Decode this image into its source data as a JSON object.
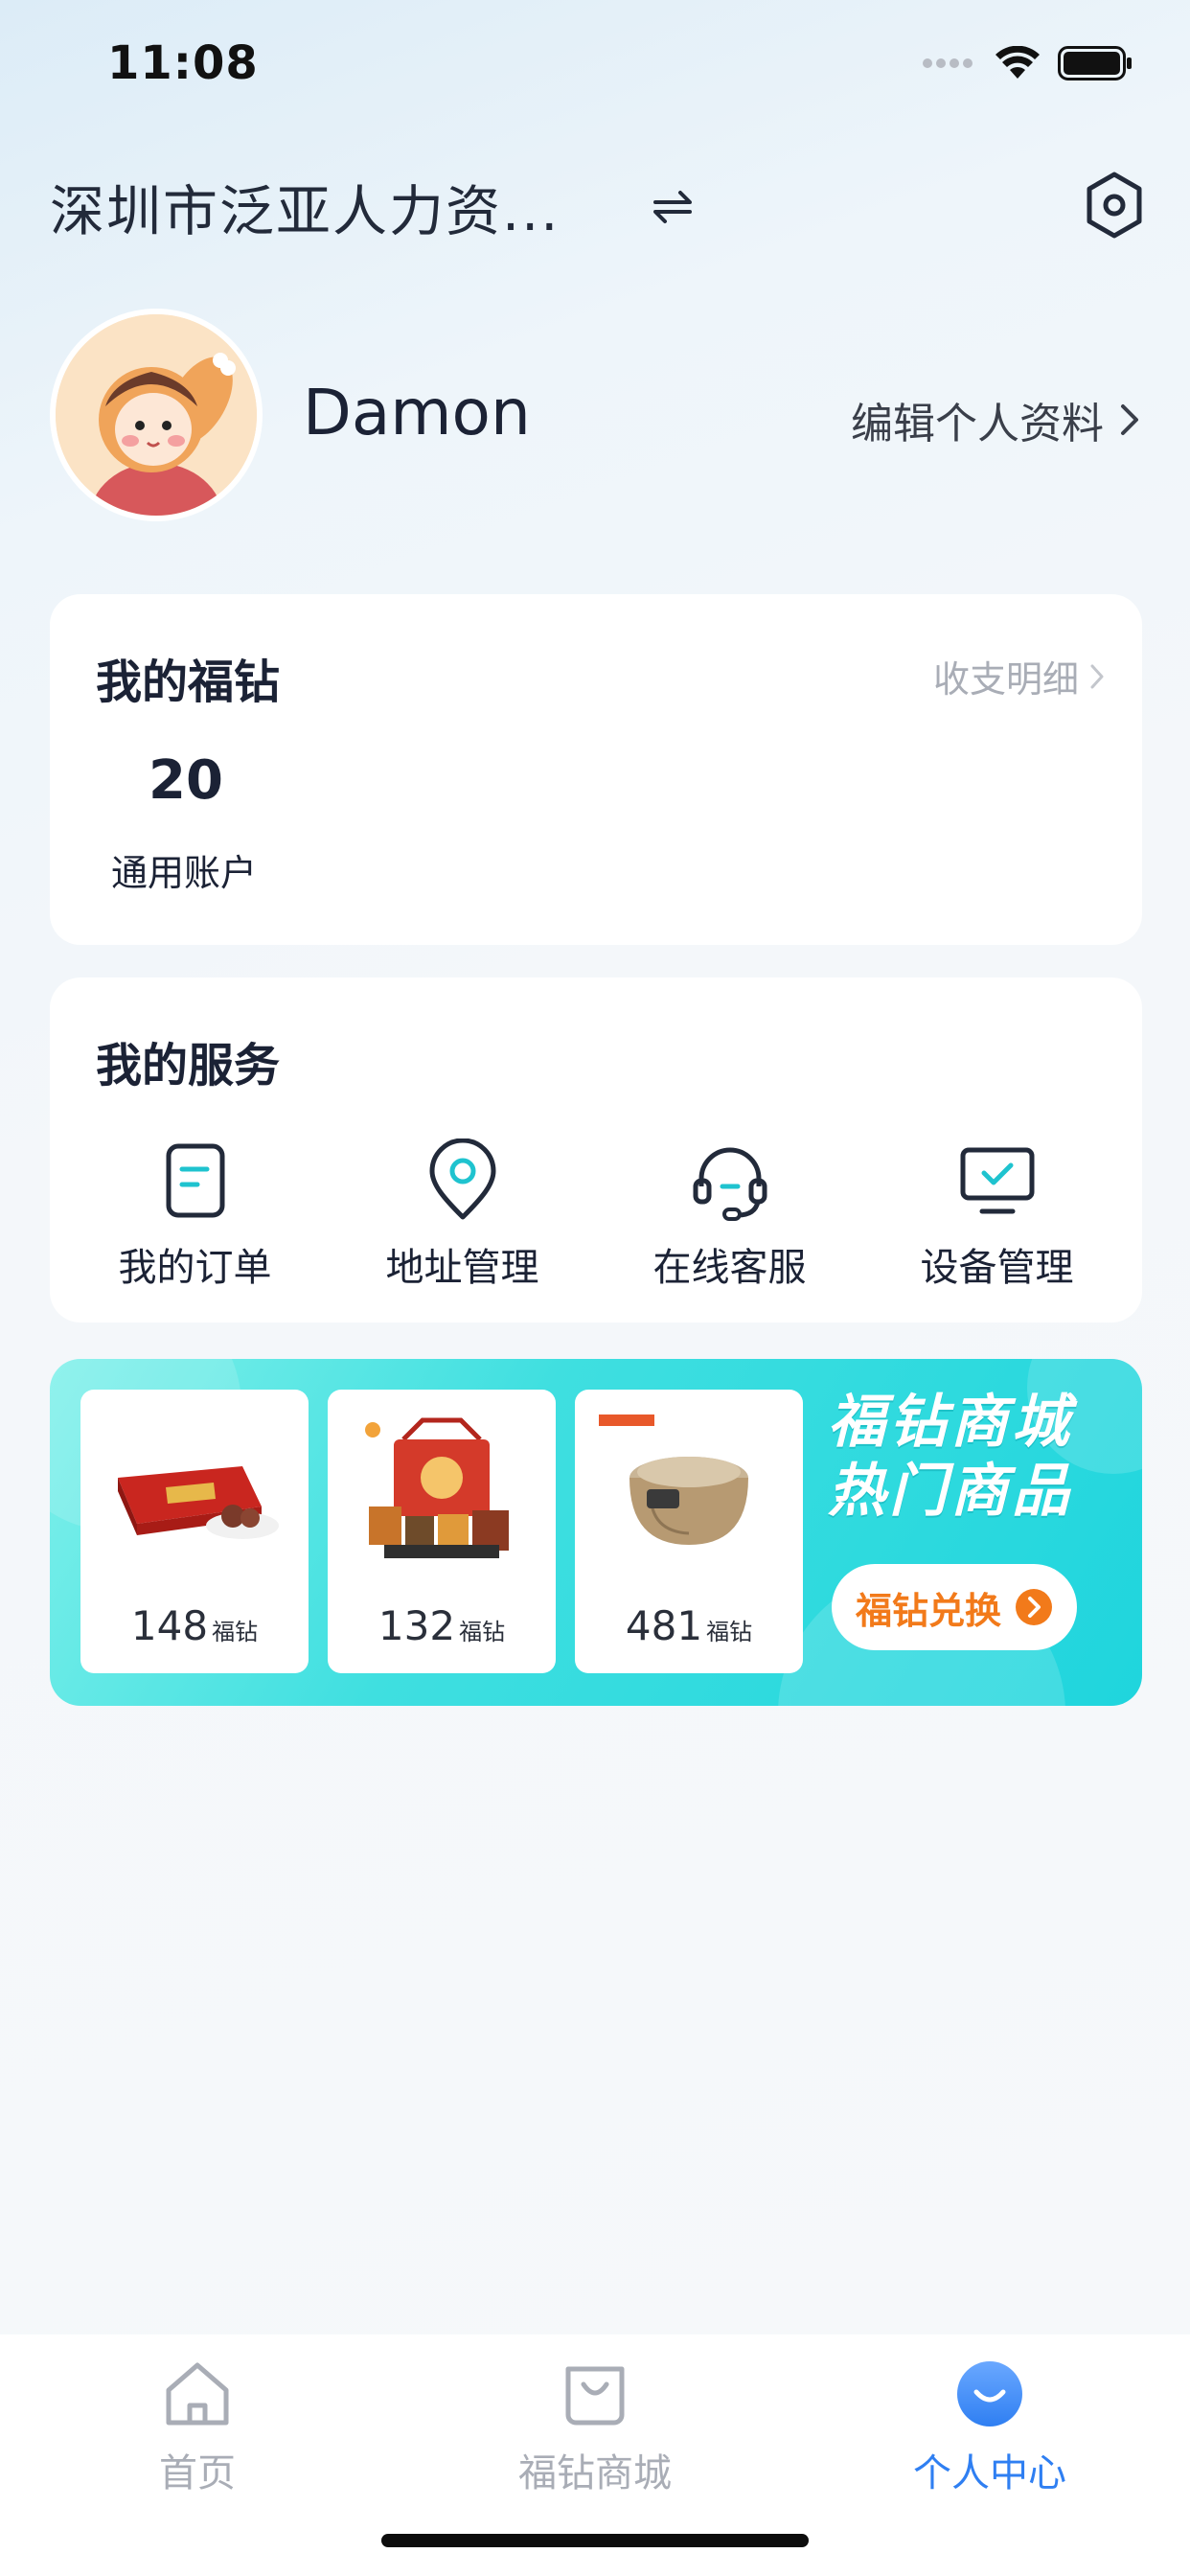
{
  "status_bar": {
    "time": "11:08"
  },
  "header": {
    "company_name": "深圳市泛亚人力资...",
    "switch_icon": "switch-arrows-icon",
    "settings_icon": "settings-hexagon-icon"
  },
  "profile": {
    "username": "Damon",
    "edit_label": "编辑个人资料"
  },
  "wallet": {
    "title": "我的福钻",
    "detail_link": "收支明细",
    "balance": "20",
    "balance_label": "通用账户"
  },
  "services": {
    "title": "我的服务",
    "items": [
      {
        "label": "我的订单",
        "icon": "order-document-icon"
      },
      {
        "label": "地址管理",
        "icon": "location-pin-icon"
      },
      {
        "label": "在线客服",
        "icon": "headset-icon"
      },
      {
        "label": "设备管理",
        "icon": "monitor-check-icon"
      }
    ]
  },
  "banner": {
    "title_line1": "福钻商城",
    "title_line2": "热门商品",
    "button_label": "福钻兑换",
    "products": [
      {
        "price": "148",
        "unit": "福钻"
      },
      {
        "price": "132",
        "unit": "福钻"
      },
      {
        "price": "481",
        "unit": "福钻"
      }
    ]
  },
  "tabbar": {
    "tabs": [
      {
        "label": "首页",
        "icon": "home-icon"
      },
      {
        "label": "福钻商城",
        "icon": "shopping-bag-icon"
      },
      {
        "label": "个人中心",
        "icon": "profile-smile-icon"
      }
    ],
    "active_color": "#2f7ff2",
    "inactive_color": "#a9adb6"
  },
  "colors": {
    "accent": "#2f7ff2",
    "service_icon": "#1fc3cf",
    "banner_button": "#f27a1a"
  }
}
